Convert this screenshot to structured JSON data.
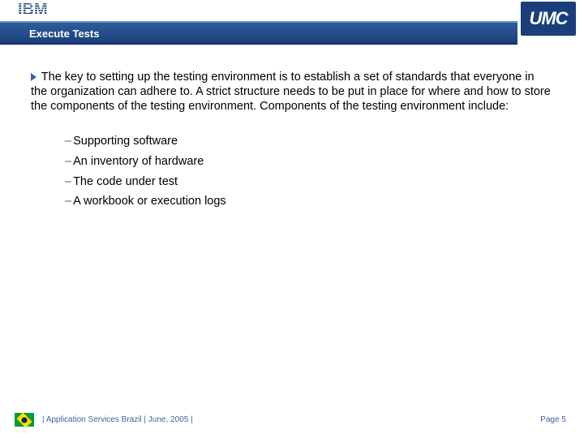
{
  "header": {
    "ibm_logo_text": "IBM",
    "umc_logo_text": "UMC",
    "title": "Execute Tests"
  },
  "body": {
    "paragraph": "The key to setting up the testing environment is to establish a set of standards that everyone in the organization can adhere to. A strict structure needs to be put in place for where and how to store the components of the testing environment. Components of the testing environment include:",
    "items": [
      "Supporting software",
      "An inventory of hardware",
      "The code under test",
      "A workbook or execution logs"
    ]
  },
  "footer": {
    "text": "|  Application Services Brazil  |  June, 2005  |",
    "page_label": "Page 5"
  }
}
